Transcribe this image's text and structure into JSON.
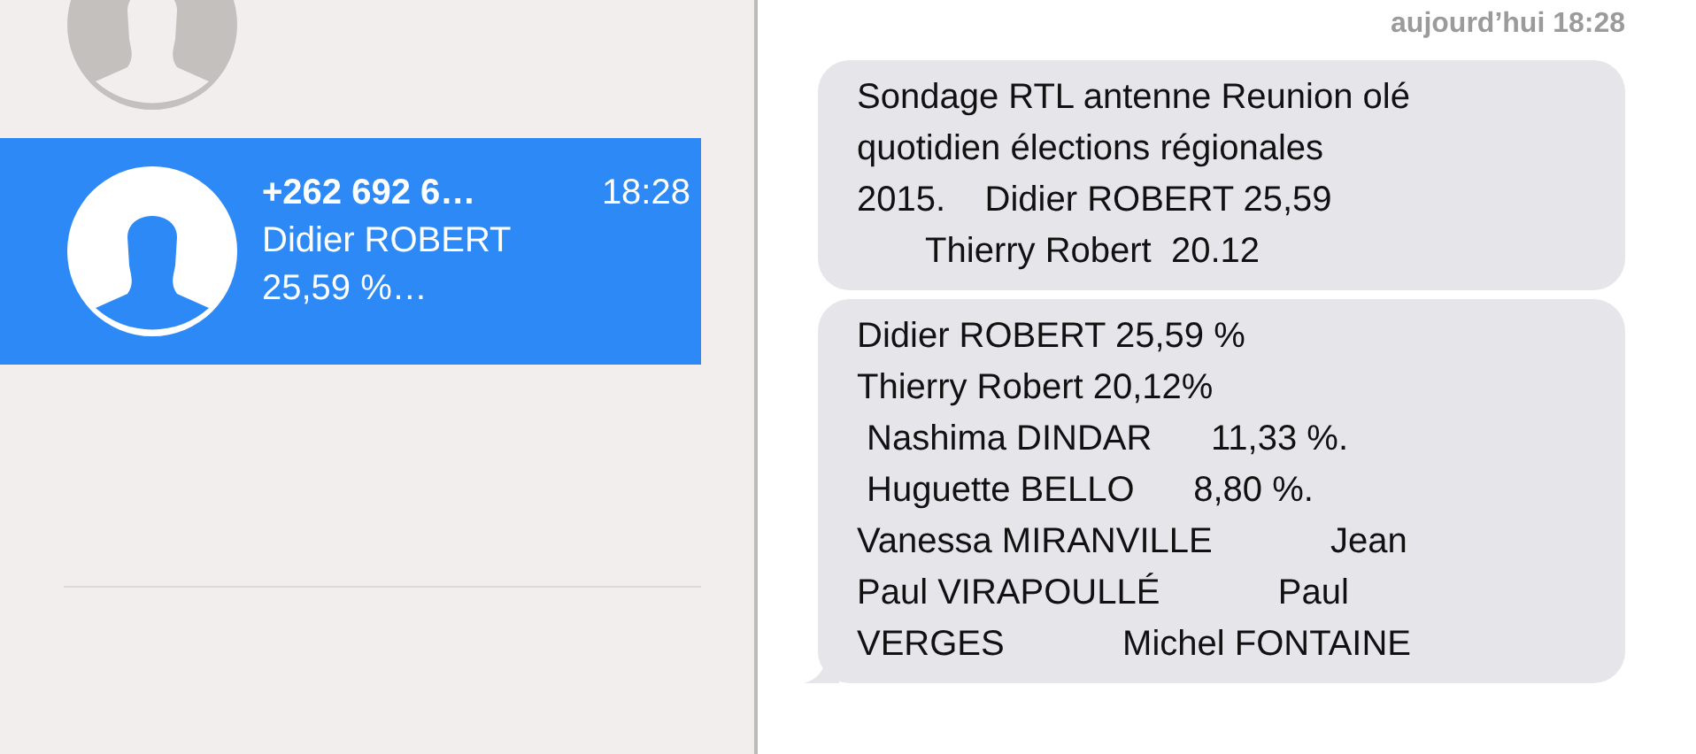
{
  "conversations": [
    {
      "selected": false
    },
    {
      "selected": true,
      "sender": "+262 692 6…",
      "time": "18:28",
      "preview": "Didier ROBERT\n25,59 %…"
    }
  ],
  "thread": {
    "timestamp": "aujourd’hui 18:28",
    "messages": [
      {
        "text": "Sondage RTL antenne Reunion olé\nquotidien élections régionales\n2015.    Didier ROBERT 25,59\n       Thierry Robert  20.12",
        "tail": false
      },
      {
        "text": "Didier ROBERT 25,59 %\nThierry Robert 20,12%\n Nashima DINDAR      11,33 %.\n Huguette BELLO      8,80 %.\nVanessa MIRANVILLE            Jean\nPaul VIRAPOULLÉ            Paul\nVERGES            Michel FONTAINE",
        "tail": true
      }
    ]
  }
}
